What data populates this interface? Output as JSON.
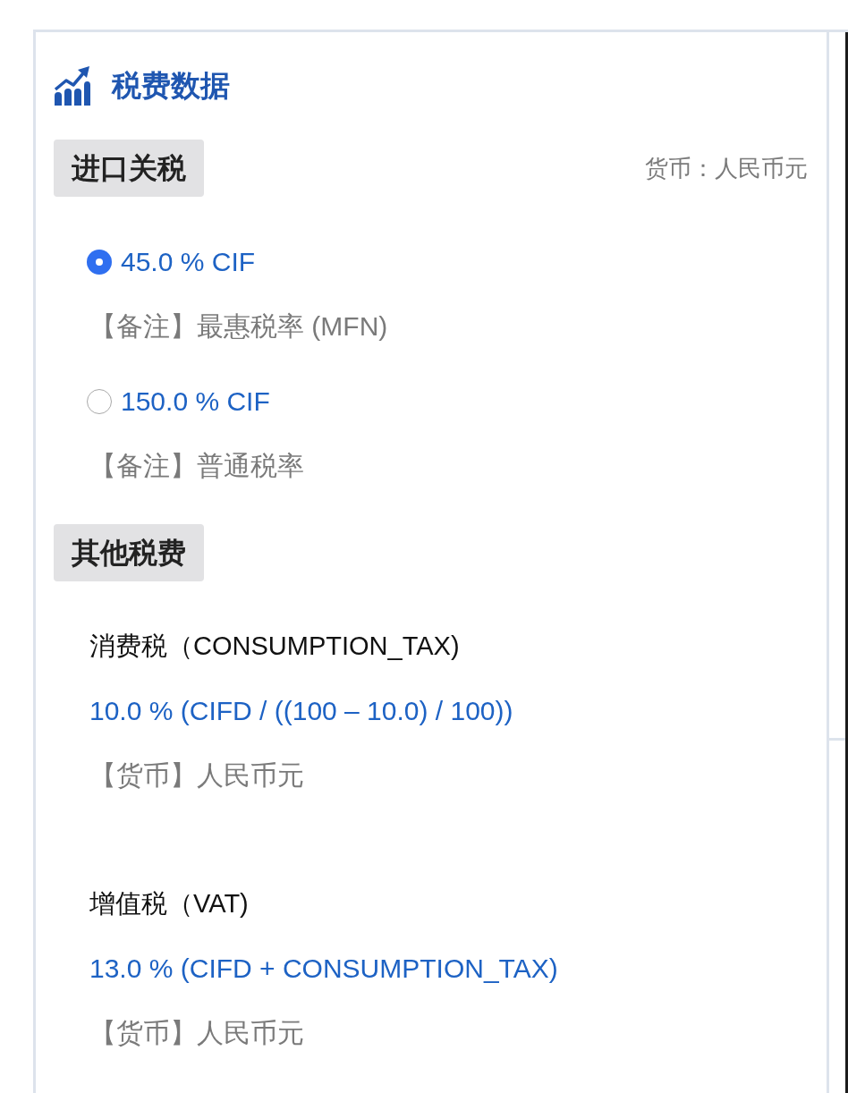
{
  "panel": {
    "title": "税费数据"
  },
  "import_duty": {
    "heading": "进口关税",
    "currency": "货币：人民币元",
    "options": [
      {
        "rate": "45.0 % CIF",
        "note": "【备注】最惠税率 (MFN)",
        "selected": true
      },
      {
        "rate": "150.0 % CIF",
        "note": "【备注】普通税率",
        "selected": false
      }
    ]
  },
  "other_taxes": {
    "heading": "其他税费",
    "items": [
      {
        "name": "消费税（CONSUMPTION_TAX)",
        "formula": "10.0 % (CIFD / ((100 – 10.0) / 100))",
        "currency": "【货币】人民币元"
      },
      {
        "name": "增值税（VAT)",
        "formula": "13.0 % (CIFD + CONSUMPTION_TAX)",
        "currency": "【货币】人民币元"
      }
    ]
  }
}
